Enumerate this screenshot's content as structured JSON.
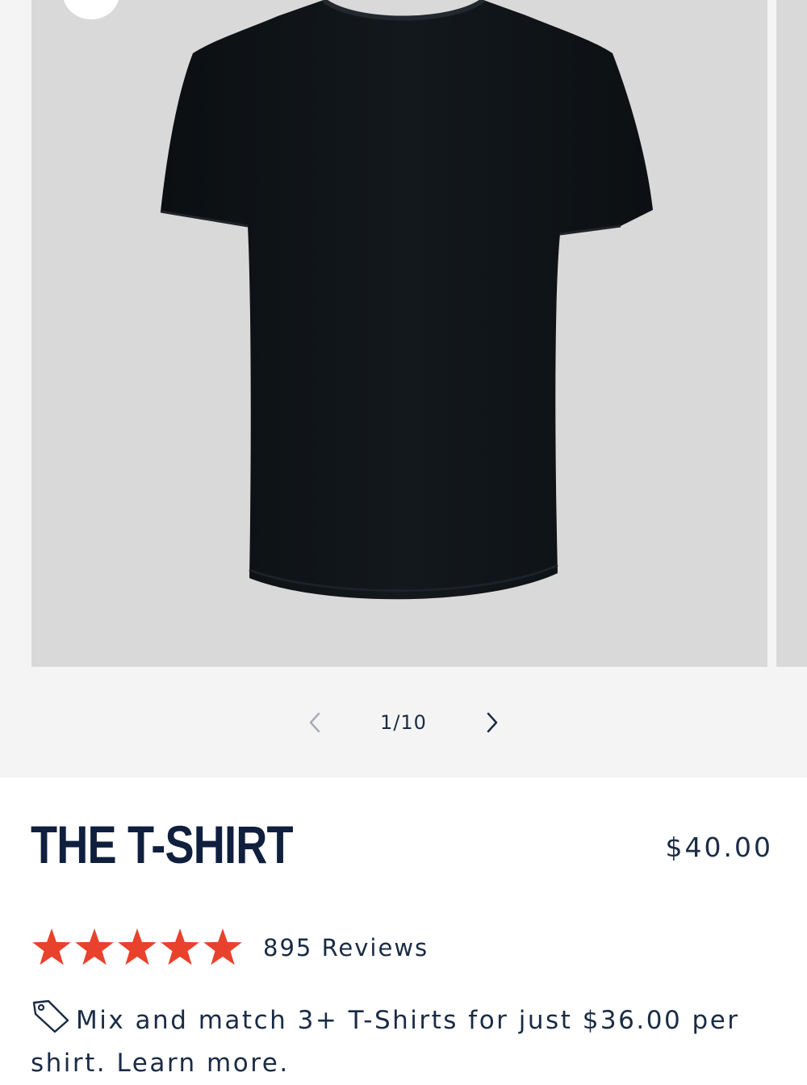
{
  "gallery": {
    "counter": "1/10",
    "image_alt": "Black crew-neck t-shirt",
    "prev_icon": "chevron-left-icon",
    "next_icon": "chevron-right-icon"
  },
  "product": {
    "title": "THE T-SHIRT",
    "price": "$40.00"
  },
  "rating": {
    "stars": 5,
    "max_stars": 5,
    "reviews_label": "895 Reviews",
    "star_color": "#e8412c"
  },
  "promo": {
    "icon": "tag-icon",
    "text": "Mix and match 3+ T-Shirts for just $36.00 per shirt.",
    "link_label": "Learn more."
  },
  "colors": {
    "navy": "#0f1f3d",
    "text": "#1a2b45",
    "gallery_bg": "#f4f4f4",
    "slide_bg": "#d9d9d9"
  }
}
